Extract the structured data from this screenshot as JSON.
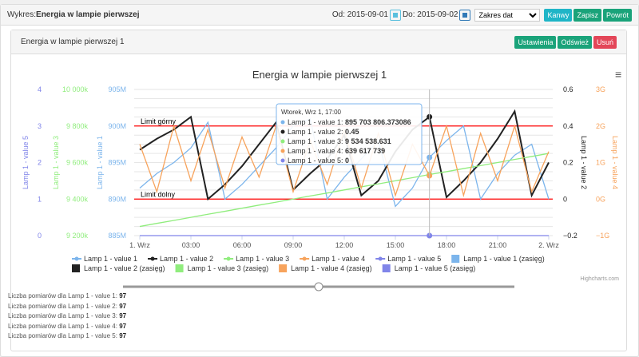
{
  "header": {
    "label": "Wykres: ",
    "title": "Energia w lampie pierwszej",
    "from_label": "Od: 2015-09-01",
    "to_label": "Do: 2015-09-02",
    "range_select": "Zakres dat",
    "buttons": [
      "Kanwy",
      "Zapisz",
      "Powrót"
    ]
  },
  "panel": {
    "title": "Energia w lampie pierwszej 1",
    "buttons": [
      "Ustawienia",
      "Odśwież",
      "Usuń"
    ]
  },
  "colors": {
    "v1": "#7cb5ec",
    "v2": "#222222",
    "v3": "#90ed7d",
    "v4": "#f7a35c",
    "v5": "#8085e9",
    "limit": "#ff0000"
  },
  "chart_data": {
    "type": "line",
    "title": "Energia w lampie pierwszej 1",
    "x_ticks": [
      "1. Wrz",
      "03:00",
      "06:00",
      "09:00",
      "12:00",
      "15:00",
      "18:00",
      "21:00",
      "2. Wrz"
    ],
    "axes": {
      "v1": {
        "label": "Lamp 1 - value 1",
        "range": [
          885,
          905
        ],
        "ticks": [
          "885M",
          "890M",
          "895M",
          "900M",
          "905M"
        ]
      },
      "v3": {
        "label": "Lamp 1 - value 3",
        "range": [
          9200,
          10000
        ],
        "ticks": [
          "9 200k",
          "9 400k",
          "9 600k",
          "9 800k",
          "10 000k"
        ]
      },
      "v5": {
        "label": "Lamp 1 - value 5",
        "range": [
          0,
          4
        ],
        "ticks": [
          "0",
          "1",
          "2",
          "3",
          "4"
        ]
      },
      "v2": {
        "label": "Lamp 1 - value 2",
        "range": [
          -0.2,
          0.6
        ],
        "ticks": [
          "−0.2",
          "0",
          "0.2",
          "0.4",
          "0.6"
        ]
      },
      "v4": {
        "label": "Lamp 1 - value 4",
        "range": [
          -1,
          3
        ],
        "ticks": [
          "−1G",
          "0G",
          "1G",
          "2G",
          "3G"
        ]
      }
    },
    "plot_lines": [
      {
        "label": "Limit górny",
        "value": 900,
        "axis": "v1"
      },
      {
        "label": "Limit dolny",
        "value": 890,
        "axis": "v1"
      }
    ],
    "x_hours": [
      0,
      1,
      2,
      3,
      4,
      5,
      6,
      7,
      8,
      9,
      10,
      11,
      12,
      13,
      14,
      15,
      16,
      17,
      18,
      19,
      20,
      21,
      22,
      23,
      24
    ],
    "series": [
      {
        "name": "Lamp 1 - value 1",
        "axis": "v1",
        "values": [
          891.5,
          893.5,
          895,
          897,
          900.5,
          890,
          892,
          894.5,
          897,
          900,
          901,
          890,
          893,
          895.5,
          898,
          889,
          891.5,
          895.7,
          898,
          900,
          890,
          893.5,
          896,
          897.5,
          890
        ]
      },
      {
        "name": "Lamp 1 - value 2",
        "axis": "v2",
        "values": [
          0.27,
          0.33,
          0.38,
          0.45,
          0.0,
          0.08,
          0.18,
          0.3,
          0.42,
          0.05,
          0.14,
          0.22,
          0.35,
          0.02,
          0.1,
          0.26,
          0.38,
          0.45,
          0.01,
          0.1,
          0.2,
          0.33,
          0.48,
          0.02,
          0.2
        ]
      },
      {
        "name": "Lamp 1 - value 3",
        "axis": "v3",
        "values": [
          9250,
          9267,
          9283,
          9300,
          9317,
          9333,
          9350,
          9367,
          9383,
          9400,
          9417,
          9433,
          9450,
          9467,
          9483,
          9500,
          9517,
          9534.5,
          9550,
          9567,
          9583,
          9600,
          9617,
          9633,
          9650
        ]
      },
      {
        "name": "Lamp 1 - value 4",
        "axis": "v4",
        "values": [
          1.5,
          0.2,
          2.0,
          0.5,
          1.9,
          0.3,
          1.7,
          0.6,
          2.0,
          0.2,
          1.6,
          0.4,
          1.9,
          0.3,
          1.8,
          0.1,
          1.5,
          0.64,
          2.0,
          0.1,
          1.8,
          0.5,
          2.0,
          0.2,
          1.3
        ]
      },
      {
        "name": "Lamp 1 - value 5",
        "axis": "v5",
        "values": [
          0,
          0,
          0,
          0,
          0,
          0,
          0,
          0,
          0,
          0,
          0,
          0,
          0,
          0,
          0,
          0,
          0,
          0,
          0,
          0,
          0,
          0,
          0,
          0,
          0
        ]
      }
    ],
    "legend": [
      "Lamp 1 - value 1",
      "Lamp 1 - value 2",
      "Lamp 1 - value 3",
      "Lamp 1 - value 4",
      "Lamp 1 - value 5",
      "Lamp 1 - value 1 (zasięg)",
      "Lamp 1 - value 2 (zasięg)",
      "Lamp 1 - value 3 (zasięg)",
      "Lamp 1 - value 4 (zasięg)",
      "Lamp 1 - value 5 (zasięg)"
    ],
    "legend_placement": "bottom",
    "tooltip": {
      "header": "Wtorek, Wrz 1, 17:00",
      "rows": [
        {
          "label": "Lamp 1 - value 1: ",
          "value": "895 703 806.373086"
        },
        {
          "label": "Lamp 1 - value 2: ",
          "value": "0.45"
        },
        {
          "label": "Lamp 1 - value 3: ",
          "value": "9 534 538.631"
        },
        {
          "label": "Lamp 1 - value 4: ",
          "value": "639 617 739"
        },
        {
          "label": "Lamp 1 - value 5: ",
          "value": "0"
        }
      ]
    },
    "credits": "Highcharts.com"
  },
  "slider_value": 0.5,
  "counts": [
    {
      "label": "Liczba pomiarów dla Lamp 1 - value 1: ",
      "value": "97"
    },
    {
      "label": "Liczba pomiarów dla Lamp 1 - value 2: ",
      "value": "97"
    },
    {
      "label": "Liczba pomiarów dla Lamp 1 - value 3: ",
      "value": "97"
    },
    {
      "label": "Liczba pomiarów dla Lamp 1 - value 4: ",
      "value": "97"
    },
    {
      "label": "Liczba pomiarów dla Lamp 1 - value 5: ",
      "value": "97"
    }
  ]
}
